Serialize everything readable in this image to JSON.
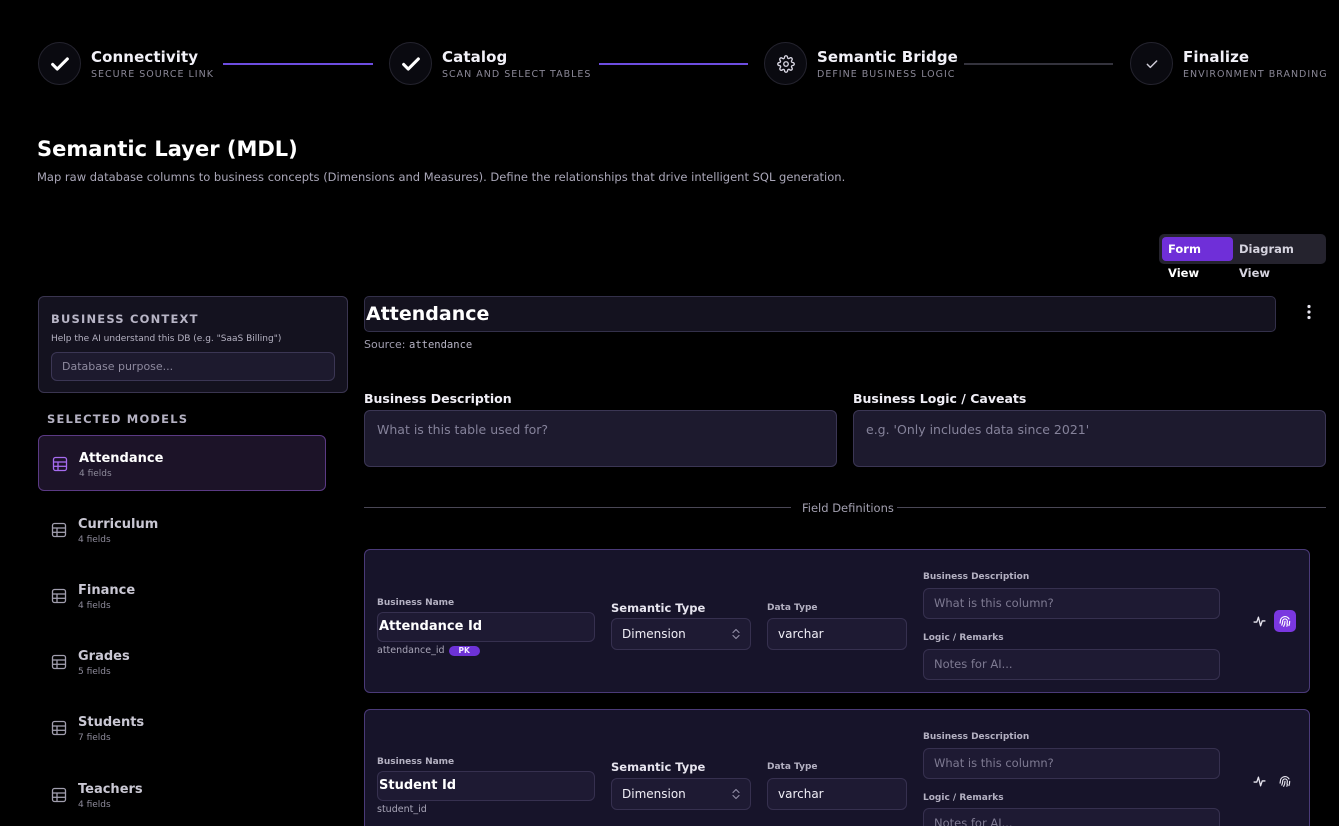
{
  "stepper": {
    "steps": [
      {
        "title": "Connectivity",
        "subtitle": "SECURE SOURCE LINK",
        "icon": "check-icon"
      },
      {
        "title": "Catalog",
        "subtitle": "SCAN AND SELECT TABLES",
        "icon": "check-icon"
      },
      {
        "title": "Semantic Bridge",
        "subtitle": "DEFINE BUSINESS LOGIC",
        "icon": "gear-icon"
      },
      {
        "title": "Finalize",
        "subtitle": "ENVIRONMENT BRANDING",
        "icon": "check-icon"
      }
    ],
    "accent": "#6d4de0"
  },
  "header": {
    "title": "Semantic Layer (MDL)",
    "description": "Map raw database columns to business concepts (Dimensions and Measures). Define the relationships that drive intelligent SQL generation."
  },
  "view_toggle": {
    "form_label": "Form View",
    "diagram_label": "Diagram View",
    "active": "Form View"
  },
  "business_context": {
    "label": "BUSINESS CONTEXT",
    "help": "Help the AI understand this DB (e.g. \"SaaS Billing\")",
    "placeholder": "Database purpose..."
  },
  "sidebar": {
    "section_label": "SELECTED MODELS",
    "models": [
      {
        "name": "Attendance",
        "fields": "4 fields",
        "active": true
      },
      {
        "name": "Curriculum",
        "fields": "4 fields"
      },
      {
        "name": "Finance",
        "fields": "4 fields"
      },
      {
        "name": "Grades",
        "fields": "5 fields"
      },
      {
        "name": "Students",
        "fields": "7 fields"
      },
      {
        "name": "Teachers",
        "fields": "4 fields"
      }
    ]
  },
  "main": {
    "table_name": "Attendance",
    "source_label": "Source:",
    "source_value": "attendance",
    "business_description_label": "Business Description",
    "business_description_placeholder": "What is this table used for?",
    "business_logic_label": "Business Logic / Caveats",
    "business_logic_placeholder": "e.g. 'Only includes data since 2021'",
    "divider_label": "Field Definitions"
  },
  "field_labels": {
    "business_name": "Business Name",
    "semantic_type": "Semantic Type",
    "data_type": "Data Type",
    "business_description": "Business Description",
    "logic_remarks": "Logic / Remarks",
    "desc_placeholder": "What is this column?",
    "logic_placeholder": "Notes for AI..."
  },
  "fields": [
    {
      "business_name": "Attendance Id",
      "column": "attendance_id",
      "pk": "PK",
      "semantic_type": "Dimension",
      "data_type": "varchar"
    },
    {
      "business_name": "Student Id",
      "column": "student_id",
      "pk": "",
      "semantic_type": "Dimension",
      "data_type": "varchar"
    }
  ]
}
